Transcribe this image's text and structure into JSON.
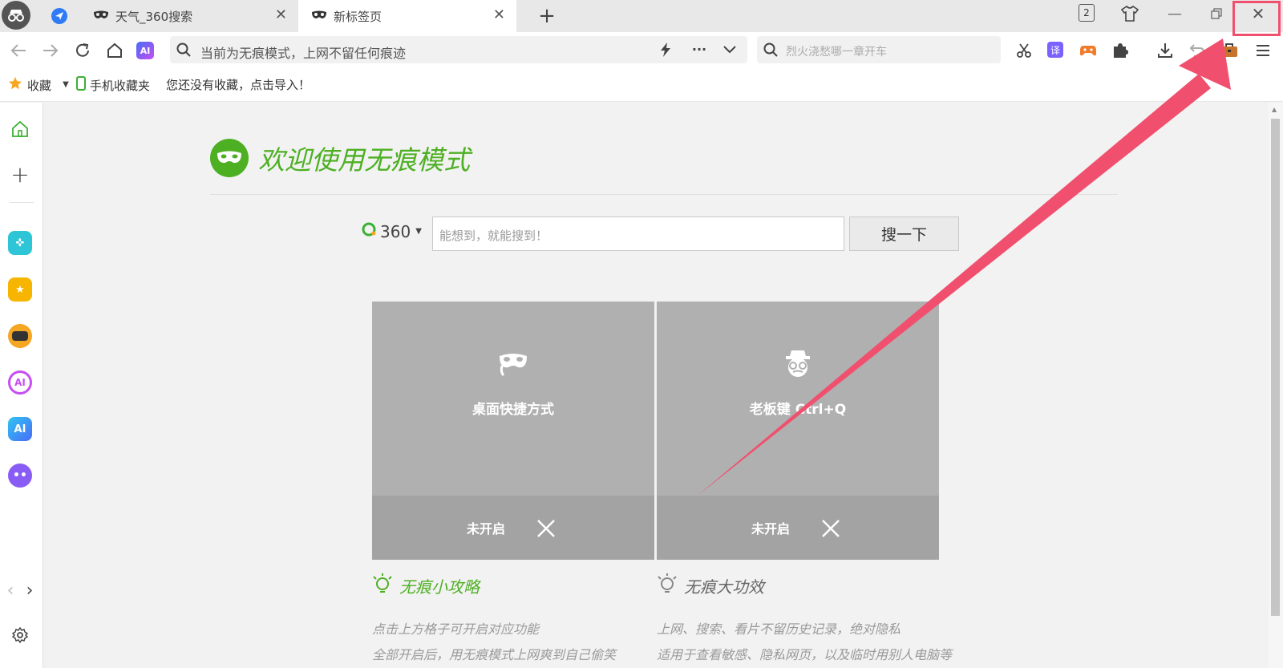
{
  "tabs": [
    {
      "title": "天气_360搜索"
    },
    {
      "title": "新标签页"
    }
  ],
  "window": {
    "tab_count": "2"
  },
  "toolbar": {
    "address_text": "当前为无痕模式，上网不留任何痕迹",
    "search_placeholder": "烈火浇愁哪一章开车"
  },
  "bookmarks": {
    "favorites_label": "收藏",
    "mobile_label": "手机收藏夹",
    "import_hint": "您还没有收藏，点击导入！"
  },
  "main": {
    "welcome_title": "欢迎使用无痕模式",
    "engine_label": "360",
    "search_placeholder": "能想到，就能搜到！",
    "search_button": "搜一下",
    "cards": [
      {
        "title": "桌面快捷方式",
        "status": "未开启"
      },
      {
        "title": "老板键 Ctrl+Q",
        "status": "未开启"
      }
    ],
    "tips_left": {
      "title": "无痕小攻略",
      "lines": [
        "点击上方格子可开启对应功能",
        "全部开启后，用无痕模式上网爽到自己偷笑"
      ]
    },
    "tips_right": {
      "title": "无痕大功效",
      "lines": [
        "上网、搜索、看片不留历史记录，绝对隐私",
        "适用于查看敏感、隐私网页，以及临时用别人电脑等"
      ]
    }
  },
  "colors": {
    "brand_green": "#4db022",
    "highlight_red": "#f0506e"
  }
}
